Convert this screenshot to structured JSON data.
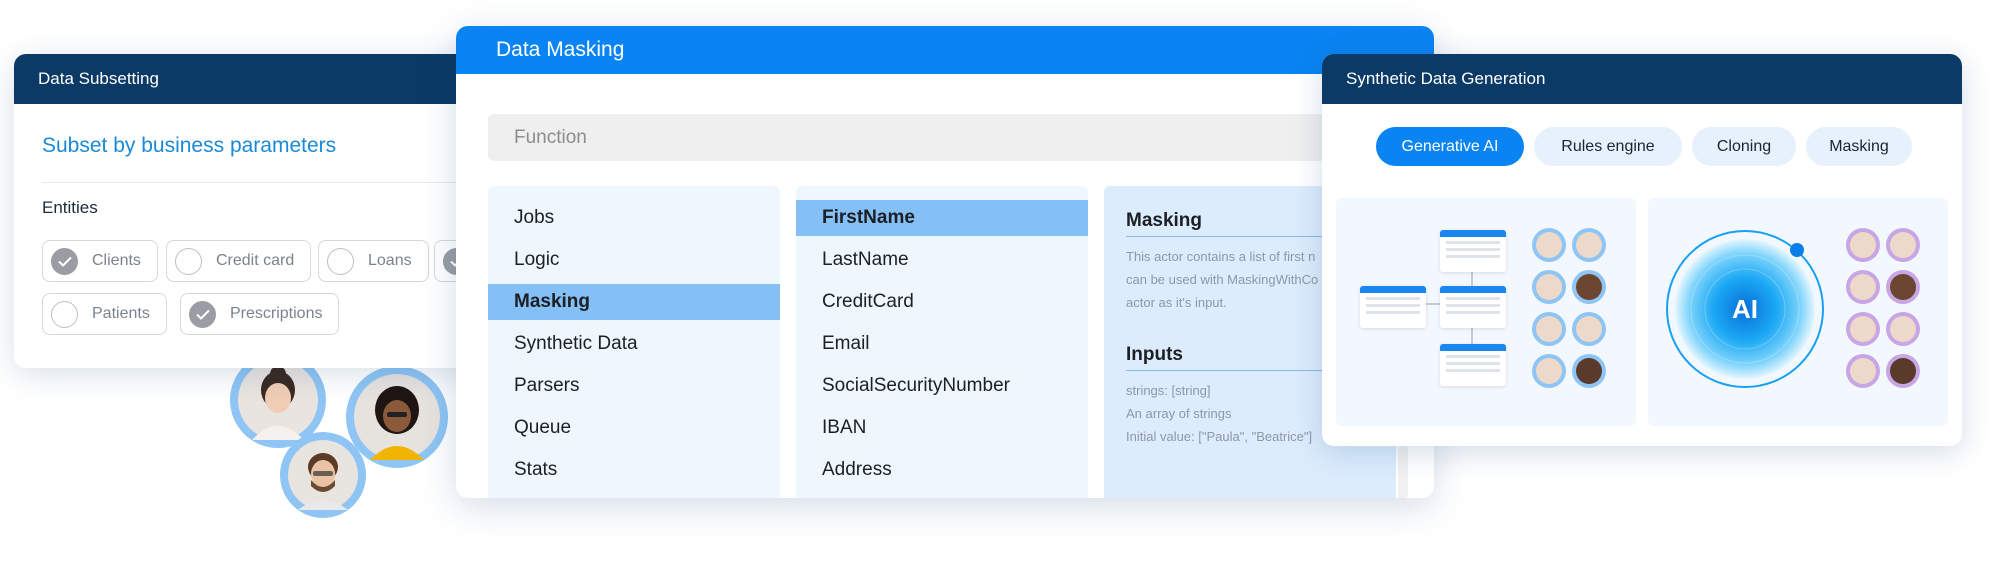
{
  "subsetting": {
    "title": "Data Subsetting",
    "heading": "Subset by business parameters",
    "entities_label": "Entities",
    "chips": [
      {
        "label": "Clients",
        "checked": true
      },
      {
        "label": "Credit card",
        "checked": false
      },
      {
        "label": "Loans",
        "checked": false
      },
      {
        "label": "Patients",
        "checked": false
      },
      {
        "label": "Prescriptions",
        "checked": true
      }
    ]
  },
  "masking": {
    "title": "Data Masking",
    "function_placeholder": "Function",
    "categories": [
      "Jobs",
      "Logic",
      "Masking",
      "Synthetic Data",
      "Parsers",
      "Queue",
      "Stats"
    ],
    "selected_category": "Masking",
    "fields": [
      "FirstName",
      "LastName",
      "CreditCard",
      "Email",
      "SocialSecurityNumber",
      "IBAN",
      "Address"
    ],
    "selected_field": "FirstName",
    "detail": {
      "heading": "Masking",
      "description_lines": [
        "This actor contains a list of first n",
        "can be used with MaskingWithCo",
        "actor as it's input."
      ],
      "inputs_heading": "Inputs",
      "inputs_lines": [
        "strings: [string]",
        "An array of strings",
        "Initial value: [\"Paula\", \"Beatrice\"]"
      ]
    }
  },
  "synthetic": {
    "title": "Synthetic Data Generation",
    "tabs": [
      "Generative AI",
      "Rules engine",
      "Cloning",
      "Masking"
    ],
    "active_tab": "Generative AI",
    "ai_label": "AI"
  },
  "colors": {
    "navy": "#0b3a66",
    "blue": "#0a84f2",
    "selected": "#84bff6",
    "link": "#1a8ad8"
  }
}
